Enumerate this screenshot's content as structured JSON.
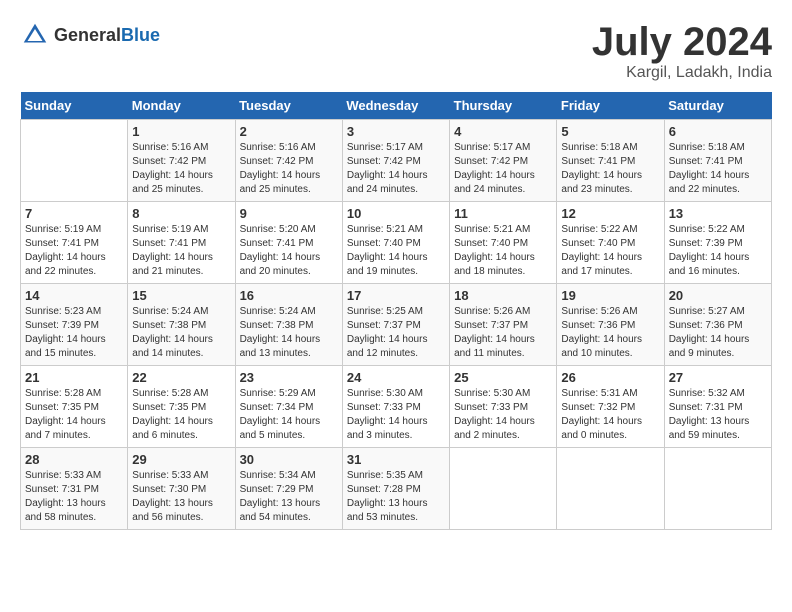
{
  "logo": {
    "general": "General",
    "blue": "Blue"
  },
  "title": {
    "month_year": "July 2024",
    "location": "Kargil, Ladakh, India"
  },
  "days_of_week": [
    "Sunday",
    "Monday",
    "Tuesday",
    "Wednesday",
    "Thursday",
    "Friday",
    "Saturday"
  ],
  "weeks": [
    [
      {
        "day": "",
        "info": ""
      },
      {
        "day": "1",
        "info": "Sunrise: 5:16 AM\nSunset: 7:42 PM\nDaylight: 14 hours\nand 25 minutes."
      },
      {
        "day": "2",
        "info": "Sunrise: 5:16 AM\nSunset: 7:42 PM\nDaylight: 14 hours\nand 25 minutes."
      },
      {
        "day": "3",
        "info": "Sunrise: 5:17 AM\nSunset: 7:42 PM\nDaylight: 14 hours\nand 24 minutes."
      },
      {
        "day": "4",
        "info": "Sunrise: 5:17 AM\nSunset: 7:42 PM\nDaylight: 14 hours\nand 24 minutes."
      },
      {
        "day": "5",
        "info": "Sunrise: 5:18 AM\nSunset: 7:41 PM\nDaylight: 14 hours\nand 23 minutes."
      },
      {
        "day": "6",
        "info": "Sunrise: 5:18 AM\nSunset: 7:41 PM\nDaylight: 14 hours\nand 22 minutes."
      }
    ],
    [
      {
        "day": "7",
        "info": "Sunrise: 5:19 AM\nSunset: 7:41 PM\nDaylight: 14 hours\nand 22 minutes."
      },
      {
        "day": "8",
        "info": "Sunrise: 5:19 AM\nSunset: 7:41 PM\nDaylight: 14 hours\nand 21 minutes."
      },
      {
        "day": "9",
        "info": "Sunrise: 5:20 AM\nSunset: 7:41 PM\nDaylight: 14 hours\nand 20 minutes."
      },
      {
        "day": "10",
        "info": "Sunrise: 5:21 AM\nSunset: 7:40 PM\nDaylight: 14 hours\nand 19 minutes."
      },
      {
        "day": "11",
        "info": "Sunrise: 5:21 AM\nSunset: 7:40 PM\nDaylight: 14 hours\nand 18 minutes."
      },
      {
        "day": "12",
        "info": "Sunrise: 5:22 AM\nSunset: 7:40 PM\nDaylight: 14 hours\nand 17 minutes."
      },
      {
        "day": "13",
        "info": "Sunrise: 5:22 AM\nSunset: 7:39 PM\nDaylight: 14 hours\nand 16 minutes."
      }
    ],
    [
      {
        "day": "14",
        "info": "Sunrise: 5:23 AM\nSunset: 7:39 PM\nDaylight: 14 hours\nand 15 minutes."
      },
      {
        "day": "15",
        "info": "Sunrise: 5:24 AM\nSunset: 7:38 PM\nDaylight: 14 hours\nand 14 minutes."
      },
      {
        "day": "16",
        "info": "Sunrise: 5:24 AM\nSunset: 7:38 PM\nDaylight: 14 hours\nand 13 minutes."
      },
      {
        "day": "17",
        "info": "Sunrise: 5:25 AM\nSunset: 7:37 PM\nDaylight: 14 hours\nand 12 minutes."
      },
      {
        "day": "18",
        "info": "Sunrise: 5:26 AM\nSunset: 7:37 PM\nDaylight: 14 hours\nand 11 minutes."
      },
      {
        "day": "19",
        "info": "Sunrise: 5:26 AM\nSunset: 7:36 PM\nDaylight: 14 hours\nand 10 minutes."
      },
      {
        "day": "20",
        "info": "Sunrise: 5:27 AM\nSunset: 7:36 PM\nDaylight: 14 hours\nand 9 minutes."
      }
    ],
    [
      {
        "day": "21",
        "info": "Sunrise: 5:28 AM\nSunset: 7:35 PM\nDaylight: 14 hours\nand 7 minutes."
      },
      {
        "day": "22",
        "info": "Sunrise: 5:28 AM\nSunset: 7:35 PM\nDaylight: 14 hours\nand 6 minutes."
      },
      {
        "day": "23",
        "info": "Sunrise: 5:29 AM\nSunset: 7:34 PM\nDaylight: 14 hours\nand 5 minutes."
      },
      {
        "day": "24",
        "info": "Sunrise: 5:30 AM\nSunset: 7:33 PM\nDaylight: 14 hours\nand 3 minutes."
      },
      {
        "day": "25",
        "info": "Sunrise: 5:30 AM\nSunset: 7:33 PM\nDaylight: 14 hours\nand 2 minutes."
      },
      {
        "day": "26",
        "info": "Sunrise: 5:31 AM\nSunset: 7:32 PM\nDaylight: 14 hours\nand 0 minutes."
      },
      {
        "day": "27",
        "info": "Sunrise: 5:32 AM\nSunset: 7:31 PM\nDaylight: 13 hours\nand 59 minutes."
      }
    ],
    [
      {
        "day": "28",
        "info": "Sunrise: 5:33 AM\nSunset: 7:31 PM\nDaylight: 13 hours\nand 58 minutes."
      },
      {
        "day": "29",
        "info": "Sunrise: 5:33 AM\nSunset: 7:30 PM\nDaylight: 13 hours\nand 56 minutes."
      },
      {
        "day": "30",
        "info": "Sunrise: 5:34 AM\nSunset: 7:29 PM\nDaylight: 13 hours\nand 54 minutes."
      },
      {
        "day": "31",
        "info": "Sunrise: 5:35 AM\nSunset: 7:28 PM\nDaylight: 13 hours\nand 53 minutes."
      },
      {
        "day": "",
        "info": ""
      },
      {
        "day": "",
        "info": ""
      },
      {
        "day": "",
        "info": ""
      }
    ]
  ]
}
